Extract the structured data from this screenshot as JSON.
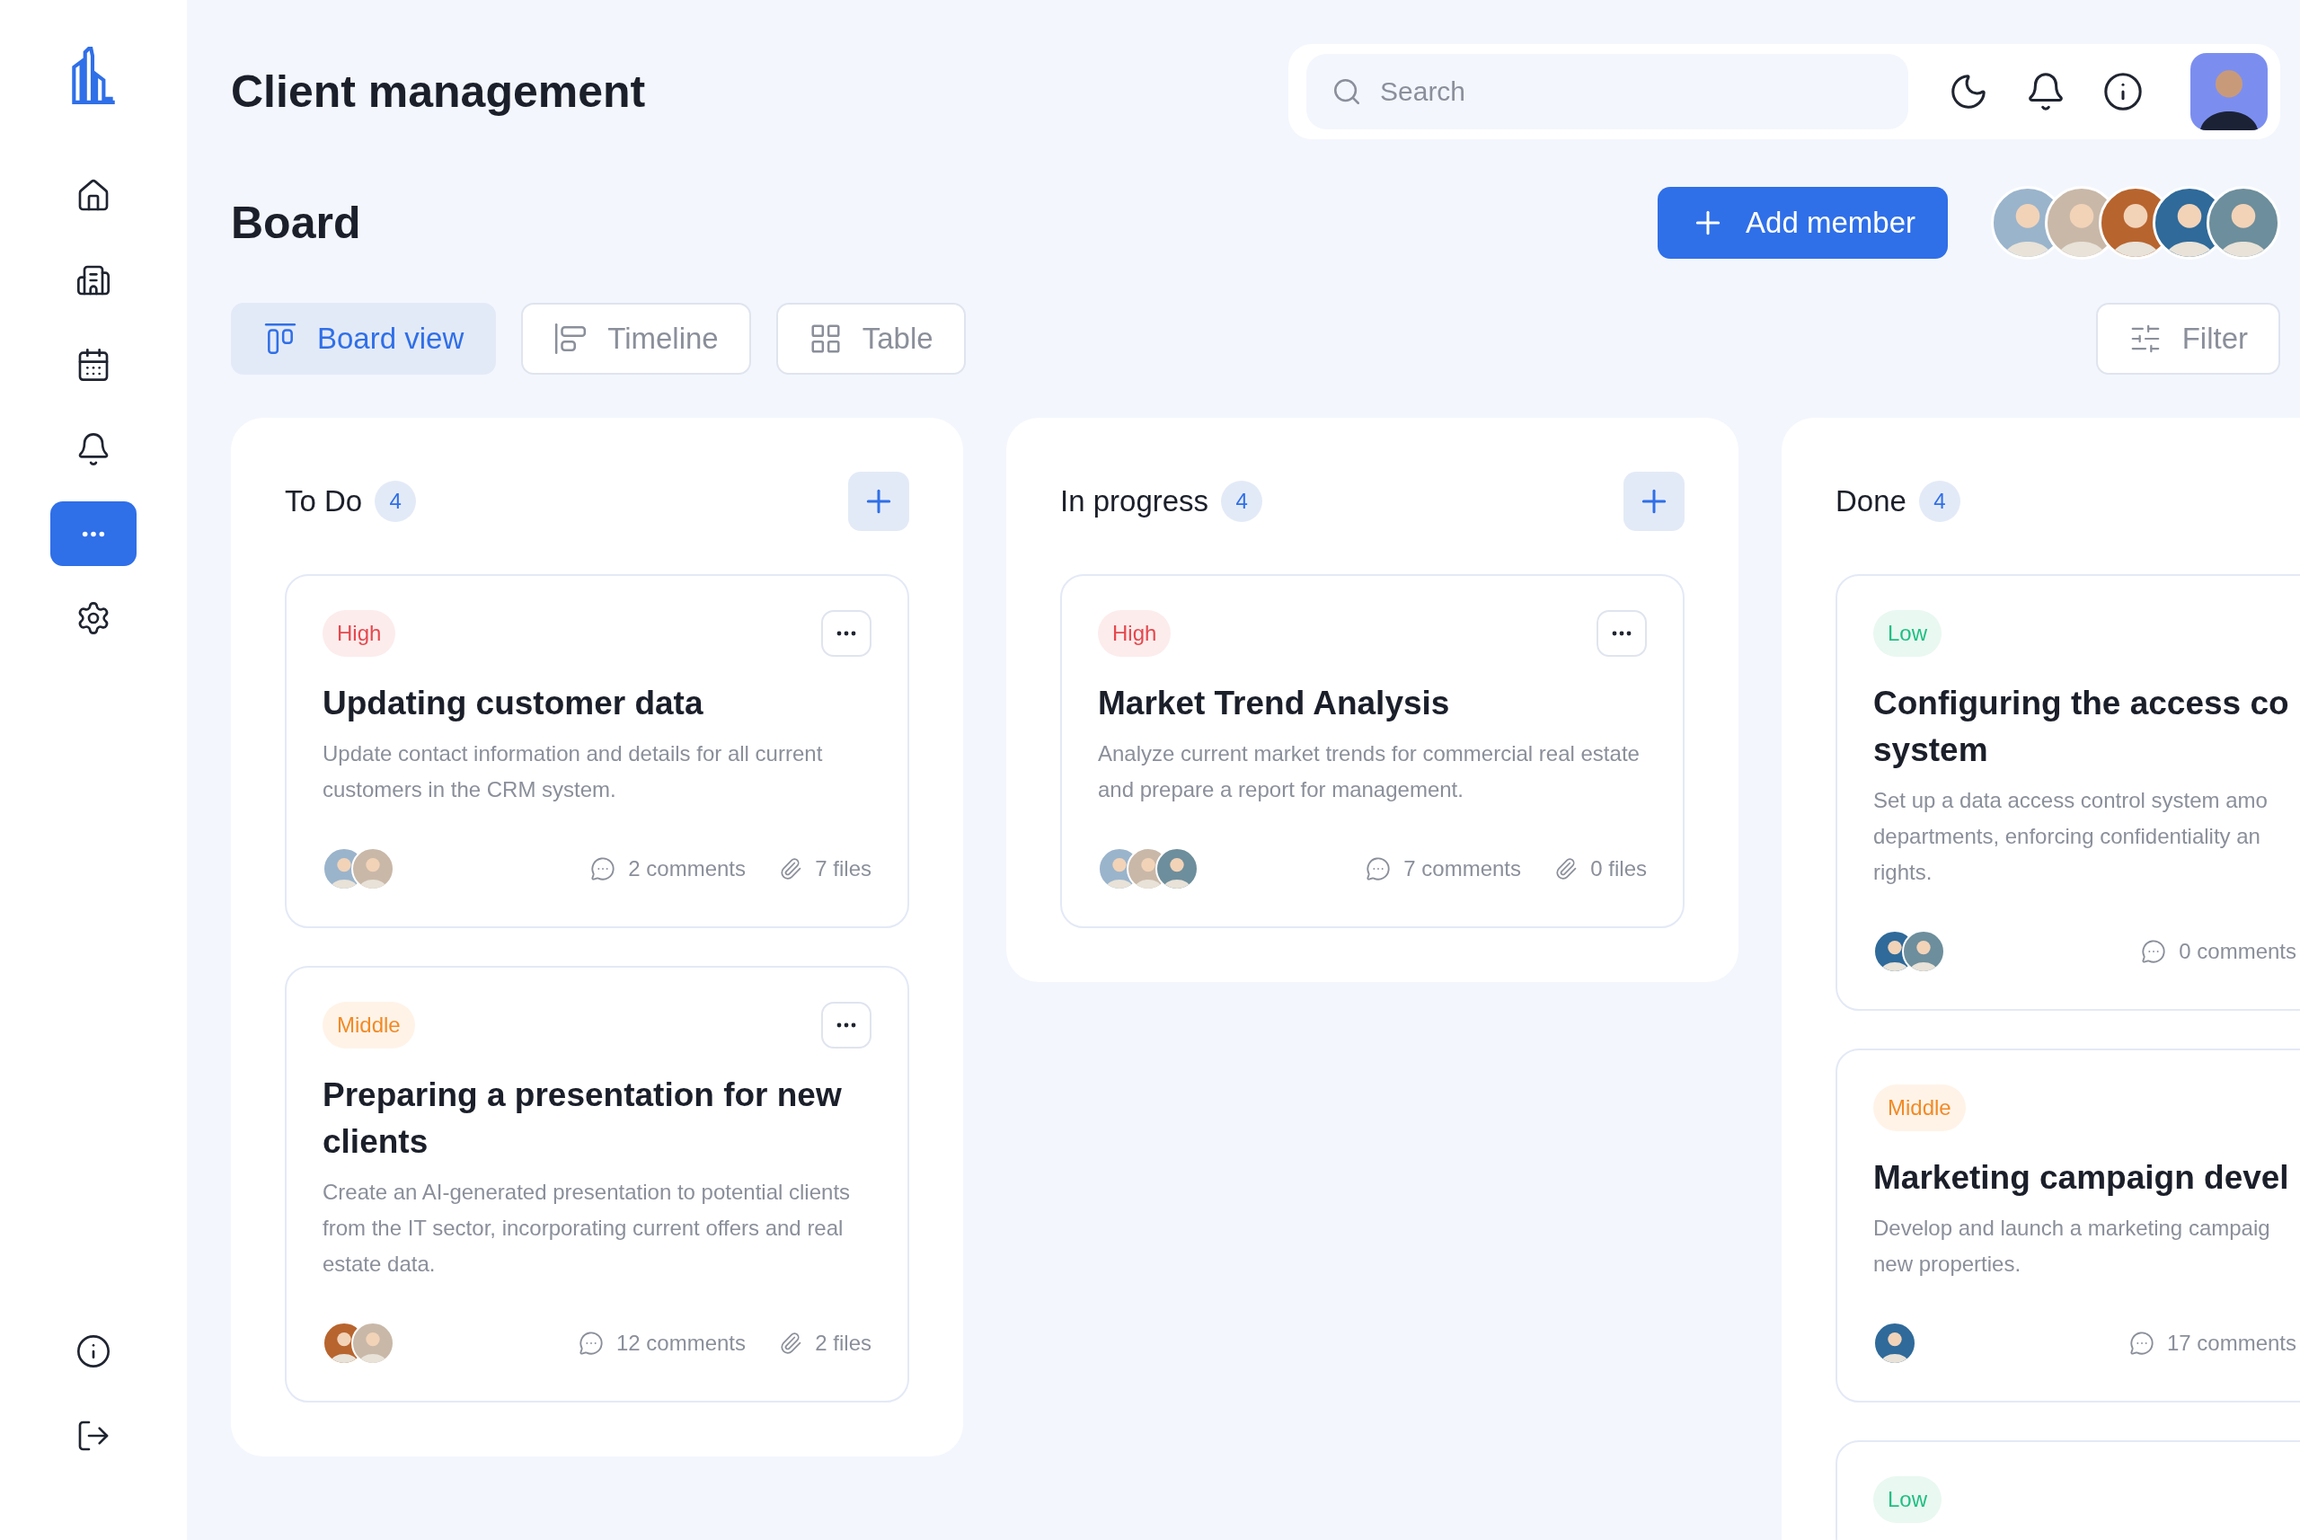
{
  "sidebar": {
    "items": [
      {
        "kind": "home",
        "selected": false
      },
      {
        "kind": "building",
        "selected": false
      },
      {
        "kind": "calendar",
        "selected": false
      },
      {
        "kind": "bell",
        "selected": false
      },
      {
        "kind": "more",
        "selected": true
      },
      {
        "kind": "settings",
        "selected": false
      }
    ],
    "bottom_items": [
      {
        "kind": "info"
      },
      {
        "kind": "logout"
      }
    ]
  },
  "header": {
    "title": "Client management",
    "search": {
      "placeholder": "Search"
    }
  },
  "board": {
    "title": "Board",
    "add_button": "Add member",
    "members": [
      {
        "color": "#9ab4cc"
      },
      {
        "color": "#c9b8a8"
      },
      {
        "color": "#b8642e"
      },
      {
        "color": "#2f6a9a"
      },
      {
        "color": "#6d8e9c"
      }
    ],
    "tabs": [
      {
        "kind": "board",
        "label": "Board view",
        "selected": true
      },
      {
        "kind": "timeline",
        "label": "Timeline",
        "selected": false
      },
      {
        "kind": "table",
        "label": "Table",
        "selected": false
      }
    ],
    "filter": "Filter"
  },
  "columns": [
    {
      "title": "To Do",
      "count": "4",
      "add": true,
      "cards": [
        {
          "kind": "high",
          "priority": "High",
          "title": "Updating customer data",
          "description": "Update contact information and details for all current customers in the CRM system.",
          "assignees": [
            {
              "color": "#9ab4cc"
            },
            {
              "color": "#c9b8a8"
            }
          ],
          "comments": "2 comments",
          "files": "7 files"
        },
        {
          "kind": "middle",
          "priority": "Middle",
          "title": "Preparing a presentation for new clients",
          "description": "Create an AI-generated presentation to potential clients from the IT sector, incorporating current offers and real estate data.",
          "assignees": [
            {
              "color": "#b8642e"
            },
            {
              "color": "#c9b8a8"
            }
          ],
          "comments": "12 comments",
          "files": "2 files"
        }
      ]
    },
    {
      "title": "In progress",
      "count": "4",
      "add": true,
      "cards": [
        {
          "kind": "high",
          "priority": "High",
          "title": "Market Trend Analysis",
          "description": "Analyze current market trends for commercial real estate and prepare a report for management.",
          "assignees": [
            {
              "color": "#9ab4cc"
            },
            {
              "color": "#c9b8a8"
            },
            {
              "color": "#6d8e9c"
            }
          ],
          "comments": "7 comments",
          "files": "0 files"
        }
      ]
    },
    {
      "title": "Done",
      "count": "4",
      "add": false,
      "cards": [
        {
          "kind": "low",
          "priority": "Low",
          "title_lines": [
            "Configuring the access co",
            "system"
          ],
          "description_lines": [
            "Set up a data access control system amo",
            "departments, enforcing confidentiality an",
            "rights."
          ],
          "assignees": [
            {
              "color": "#2f6a9a"
            },
            {
              "color": "#6d8e9c"
            }
          ],
          "comments": "0 comments"
        },
        {
          "kind": "middle",
          "priority": "Middle",
          "title_lines": [
            "Marketing campaign devel"
          ],
          "description_lines": [
            "Develop and launch a marketing campaig",
            "new properties."
          ],
          "assignees": [
            {
              "color": "#2f6a9a"
            }
          ],
          "comments": "17 comments"
        },
        {
          "kind": "low",
          "priority": "Low"
        }
      ]
    }
  ]
}
